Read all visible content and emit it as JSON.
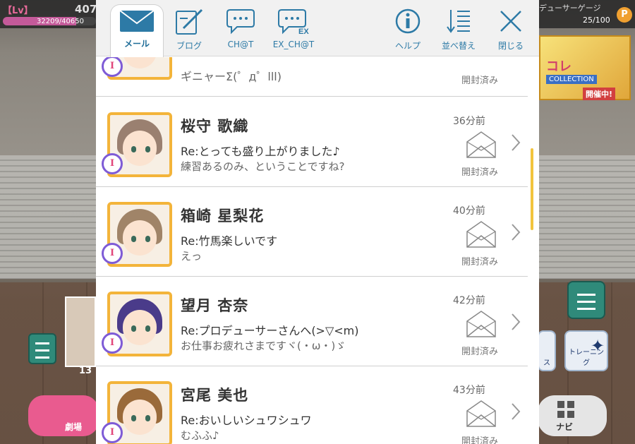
{
  "hud": {
    "level_tag": "【Lv】",
    "level": "407",
    "exp_text": "32209/40650",
    "exp_fraction": 0.79,
    "gauge_label": "デューサーゲージ",
    "gauge_text": "25/100",
    "gauge_icon": "P"
  },
  "event_banner": {
    "title": "コレ",
    "collection": "COLLECTION",
    "status": "開催中!"
  },
  "bottom": {
    "char_count": "13",
    "theater_label": "劇場",
    "lesson_label": "ス",
    "training_label": "トレーニング",
    "navi_label": "ナビ"
  },
  "toolbar": {
    "tabs": [
      {
        "label": "メール",
        "icon": "mail-icon",
        "active": true
      },
      {
        "label": "ブログ",
        "icon": "blog-icon",
        "active": false
      },
      {
        "label": "CH@T",
        "icon": "chat-icon",
        "active": false
      },
      {
        "label": "EX_CH@T",
        "icon": "ex-chat-icon",
        "active": false
      }
    ],
    "help_label": "ヘルプ",
    "sort_label": "並べ替え",
    "close_label": "閉じる"
  },
  "mail": {
    "partial": {
      "preview": "ギニャーΣ(゜д゜lll)",
      "status": "開封済み"
    },
    "items": [
      {
        "name": "桜守 歌織",
        "subject": "Re:とっても盛り上がりました♪",
        "preview": "練習あるのみ、ということですね?",
        "time": "36分前",
        "status": "開封済み",
        "hair_color": "#9a8070"
      },
      {
        "name": "箱崎 星梨花",
        "subject": "Re:竹馬楽しいです",
        "preview": "えっ",
        "time": "40分前",
        "status": "開封済み",
        "hair_color": "#a08468"
      },
      {
        "name": "望月 杏奈",
        "subject": "Re:プロデューサーさんへ(>▽<m)",
        "preview": "お仕事お疲れさまですヾ(・ω・)ゞ",
        "time": "42分前",
        "status": "開封済み",
        "hair_color": "#4a3b8a"
      },
      {
        "name": "宮尾 美也",
        "subject": "Re:おいしいシュワシュワ",
        "preview": "むふふ♪",
        "time": "43分前",
        "status": "開封済み",
        "hair_color": "#9a6a3a"
      }
    ]
  },
  "colors": {
    "accent_blue": "#2d7aa6",
    "portrait_frame": "#f3b43a",
    "scroll_thumb": "#f2c43d"
  }
}
